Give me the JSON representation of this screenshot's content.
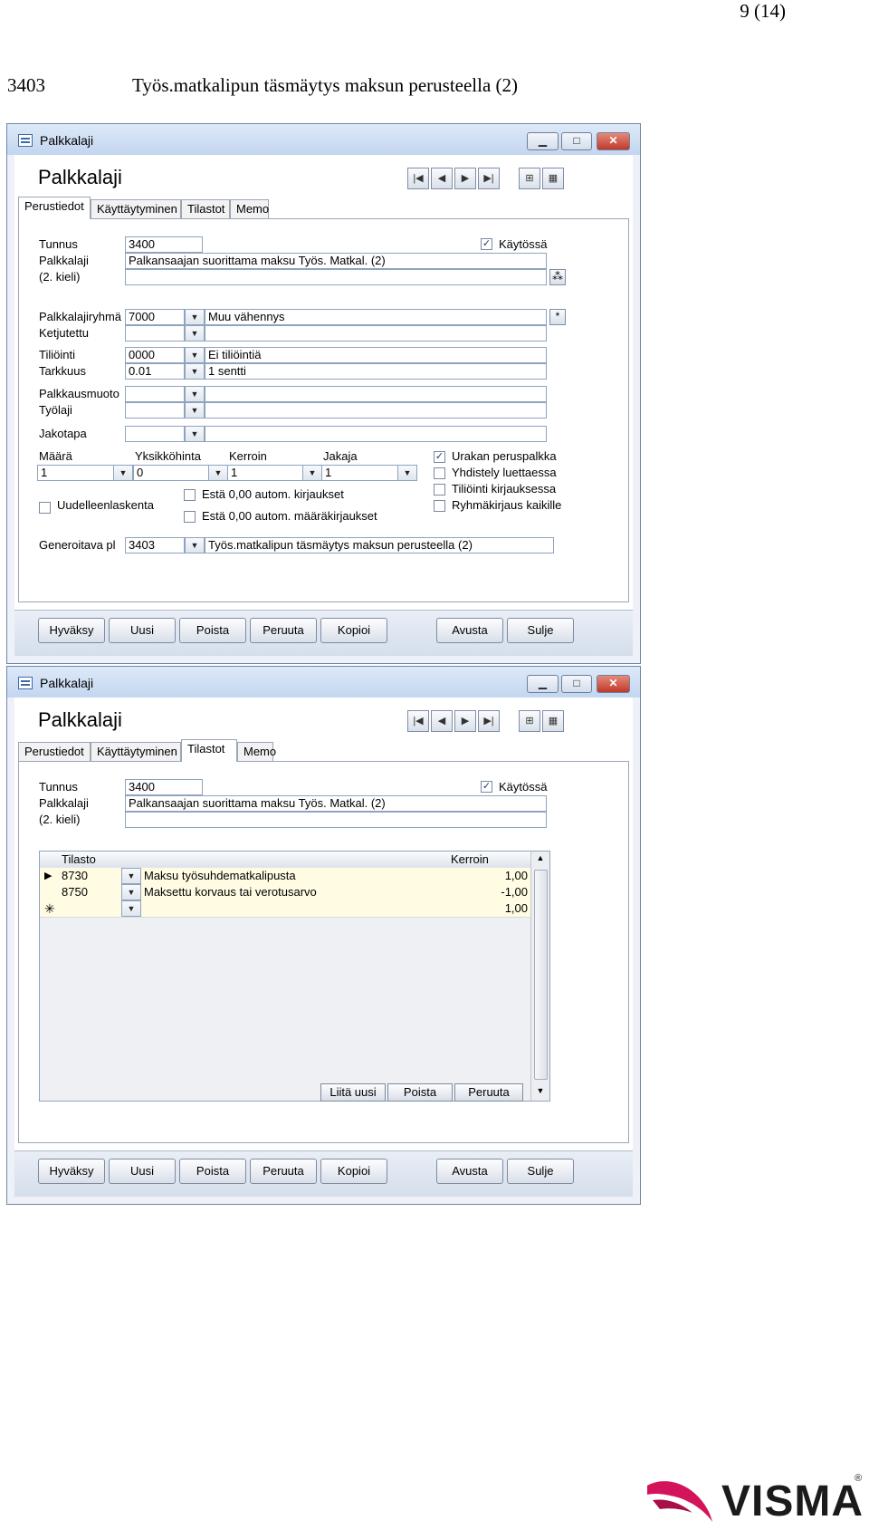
{
  "page": {
    "number": "9 (14)",
    "code": "3403",
    "title": "Työs.matkalipun täsmäytys maksun perusteella (2)"
  },
  "window1": {
    "title": "Palkkalaji",
    "form_title": "Palkkalaji",
    "tabs": [
      "Perustiedot",
      "Käyttäytyminen",
      "Tilastot",
      "Memo"
    ],
    "active_tab": "Perustiedot",
    "fields": {
      "tunnus_label": "Tunnus",
      "tunnus": "3400",
      "kaytossa": "Käytössä",
      "palkkalaji_label": "Palkkalaji",
      "palkkalaji": "Palkansaajan suorittama maksu Työs. Matkal. (2)",
      "kieli_label": "(2. kieli)",
      "kieli": "",
      "ryhma_label": "Palkkalajiryhmä",
      "ryhma_code": "7000",
      "ryhma_name": "Muu vähennys",
      "ketjutettu_label": "Ketjutettu",
      "tiliointi_label": "Tiliöinti",
      "tiliointi_code": "0000",
      "tiliointi_name": "Ei tiliöintiä",
      "tarkkuus_label": "Tarkkuus",
      "tarkkuus_code": "0.01",
      "tarkkuus_name": "1 sentti",
      "palkkausmuoto_label": "Palkkausmuoto",
      "tyolaji_label": "Työlaji",
      "jakotapa_label": "Jakotapa",
      "maara_label": "Määrä",
      "maara": "1",
      "yksikkohinta_label": "Yksikköhinta",
      "yksikkohinta": "0",
      "kerroin_label": "Kerroin",
      "kerroin": "1",
      "jakaja_label": "Jakaja",
      "jakaja": "1",
      "urakan": "Urakan peruspalkka",
      "yhdistely": "Yhdistely luettaessa",
      "tiliointi_kirjauksessa": "Tiliöinti kirjauksessa",
      "ryhmakirjaus": "Ryhmäkirjaus kaikille",
      "uudelleenlaskenta": "Uudelleenlaskenta",
      "esta1": "Estä 0,00 autom. kirjaukset",
      "esta2": "Estä 0,00 autom. määräkirjaukset",
      "generoitava_label": "Generoitava pl",
      "generoitava_code": "3403",
      "generoitava_name": "Työs.matkalipun täsmäytys maksun perusteella (2)"
    }
  },
  "window2": {
    "title": "Palkkalaji",
    "form_title": "Palkkalaji",
    "tabs": [
      "Perustiedot",
      "Käyttäytyminen",
      "Tilastot",
      "Memo"
    ],
    "active_tab": "Tilastot",
    "fields": {
      "tunnus_label": "Tunnus",
      "tunnus": "3400",
      "kaytossa": "Käytössä",
      "palkkalaji_label": "Palkkalaji",
      "palkkalaji": "Palkansaajan suorittama maksu Työs. Matkal. (2)",
      "kieli_label": "(2. kieli)"
    },
    "grid": {
      "headers": [
        "Tilasto",
        "Kerroin"
      ],
      "rows": [
        {
          "code": "8730",
          "name": "Maksu työsuhdematkalipusta",
          "kerroin": "1,00"
        },
        {
          "code": "8750",
          "name": "Maksettu korvaus tai verotusarvo",
          "kerroin": "-1,00"
        },
        {
          "code": "",
          "name": "",
          "kerroin": "1,00"
        }
      ],
      "buttons": [
        "Liitä uusi",
        "Poista",
        "Peruuta"
      ]
    }
  },
  "buttons": [
    "Hyväksy",
    "Uusi",
    "Poista",
    "Peruuta",
    "Kopioi",
    "Avusta",
    "Sulje"
  ],
  "logo": {
    "text": "VISMA",
    "mark": "®"
  },
  "colors": {
    "title_bar": "#c3d6ef",
    "grid_row": "#fffce3",
    "logo": "#d4145a"
  }
}
